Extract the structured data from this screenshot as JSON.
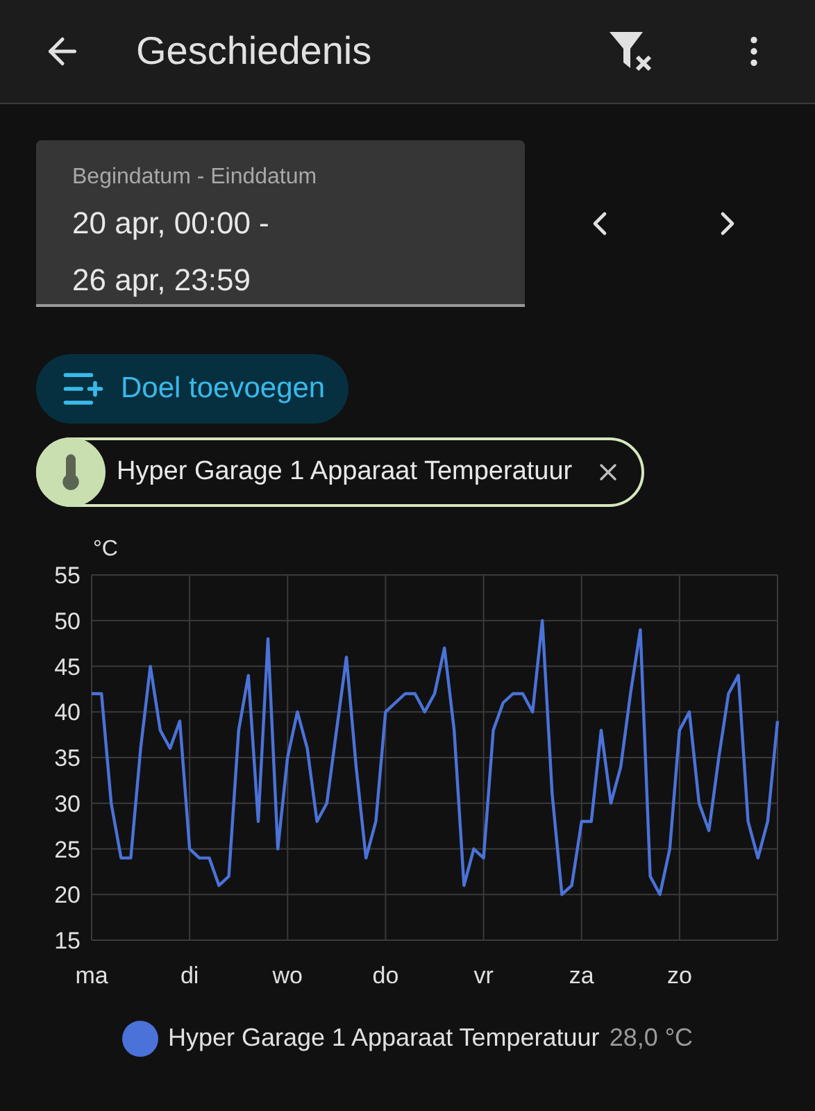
{
  "header": {
    "title": "Geschiedenis"
  },
  "date_range": {
    "label": "Begindatum - Einddatum",
    "start": "20 apr, 00:00 -",
    "end": "26 apr, 23:59"
  },
  "add_button": {
    "label": "Doel toevoegen"
  },
  "target_chip": {
    "label": "Hyper Garage 1 Apparaat Temperatuur"
  },
  "chart": {
    "chart_data": {
      "type": "line",
      "grid": true,
      "ylabel": "°C",
      "ylim": [
        15,
        55
      ],
      "yticks": [
        15,
        20,
        25,
        30,
        35,
        40,
        45,
        50,
        55
      ],
      "categories": [
        "ma",
        null,
        null,
        null,
        null,
        null,
        null,
        null,
        null,
        null,
        "di",
        null,
        null,
        null,
        null,
        null,
        null,
        null,
        null,
        null,
        "wo",
        null,
        null,
        null,
        null,
        null,
        null,
        null,
        null,
        null,
        "do",
        null,
        null,
        null,
        null,
        null,
        null,
        null,
        null,
        null,
        "vr",
        null,
        null,
        null,
        null,
        null,
        null,
        null,
        null,
        null,
        "za",
        null,
        null,
        null,
        null,
        null,
        null,
        null,
        null,
        null,
        "zo",
        null,
        null,
        null,
        null,
        null,
        null,
        null,
        null,
        null,
        null
      ],
      "series": [
        {
          "name": "Hyper Garage 1 Apparaat Temperatuur",
          "color": "#4a72d8",
          "values": [
            42,
            42,
            30,
            24,
            24,
            36,
            45,
            38,
            36,
            39,
            25,
            24,
            24,
            21,
            22,
            38,
            44,
            28,
            48,
            25,
            35,
            40,
            36,
            28,
            30,
            38,
            46,
            34,
            24,
            28,
            40,
            41,
            42,
            42,
            40,
            42,
            47,
            38,
            21,
            25,
            24,
            38,
            41,
            42,
            42,
            40,
            50,
            31,
            20,
            21,
            28,
            28,
            38,
            30,
            34,
            42,
            49,
            22,
            20,
            25,
            38,
            40,
            30,
            27,
            35,
            42,
            44,
            28,
            24,
            28,
            39
          ]
        }
      ]
    },
    "legend_value": "28,0 °C"
  }
}
